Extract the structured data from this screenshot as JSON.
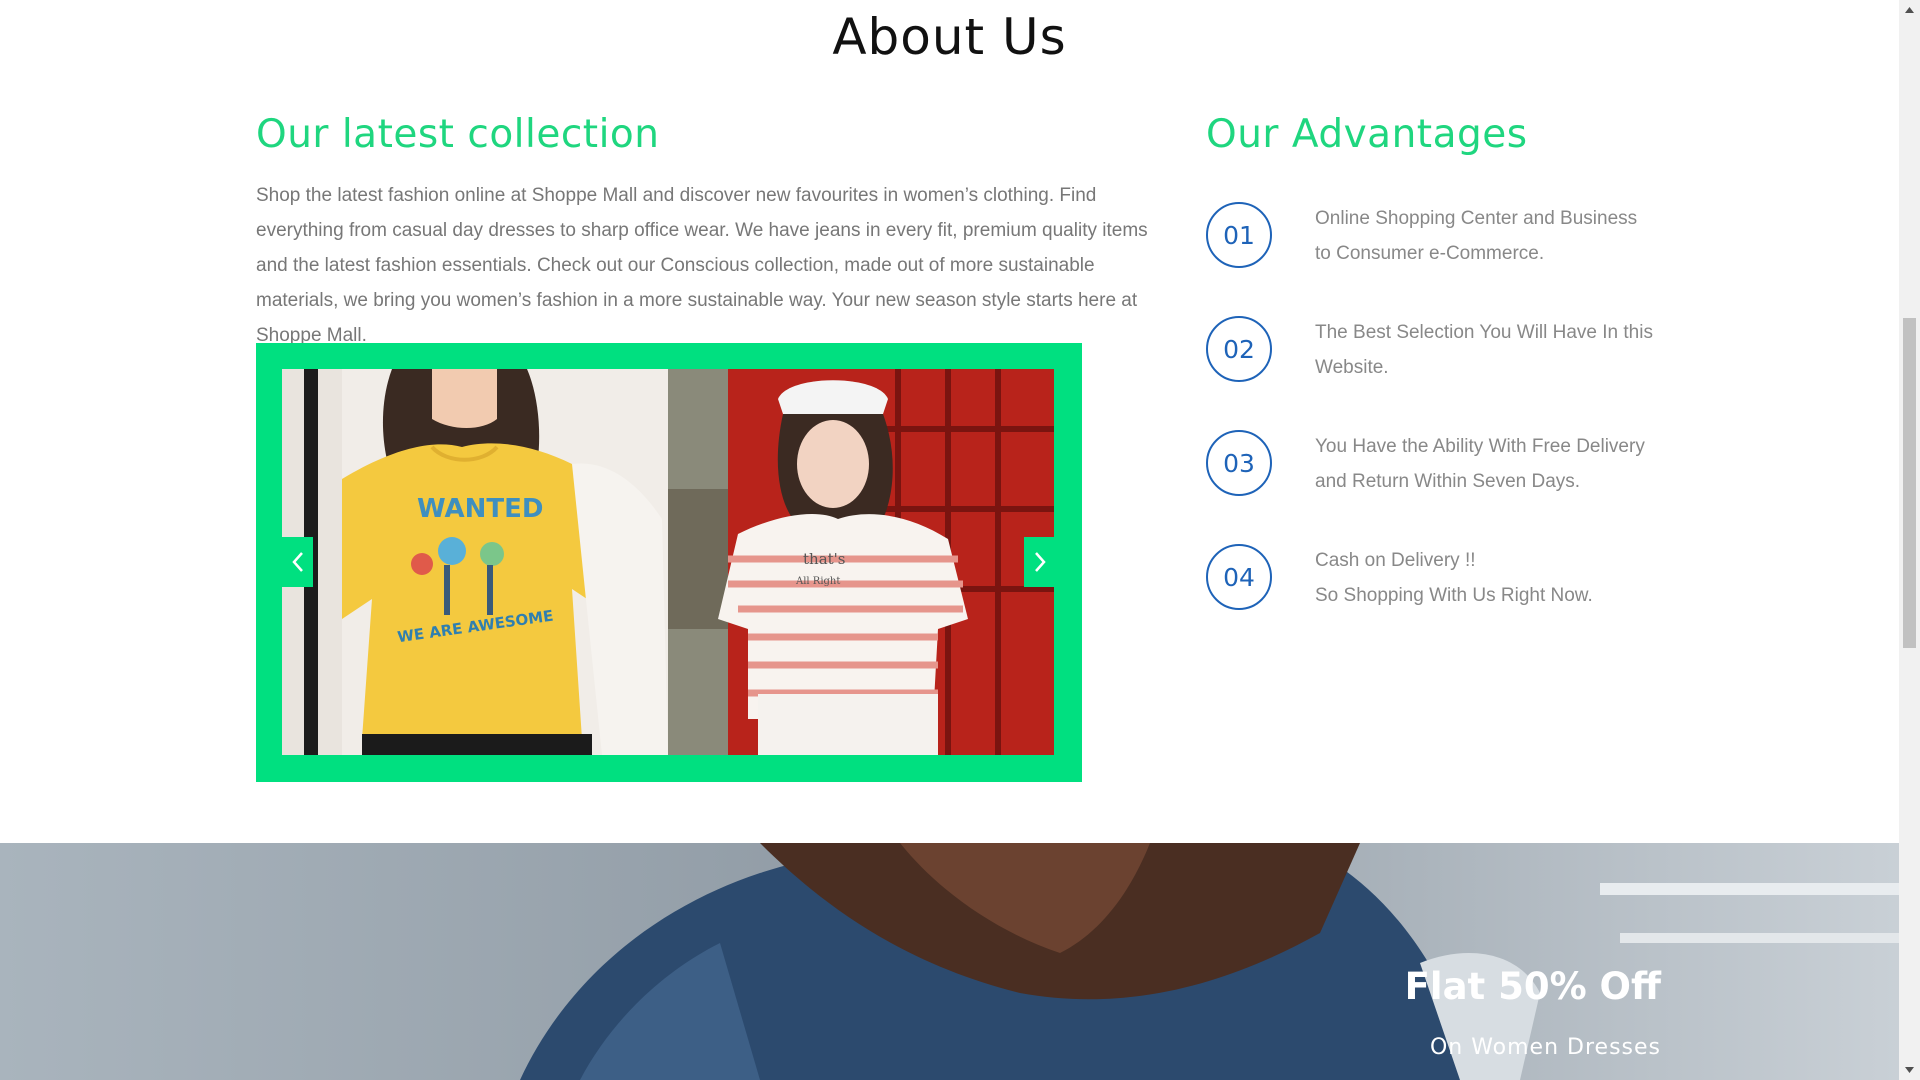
{
  "about": {
    "title": "About Us"
  },
  "collection": {
    "heading": "Our latest collection",
    "description": "Shop the latest fashion online at Shoppe Mall and discover new favourites in women’s clothing. Find everything from casual day dresses to sharp office wear. We have jeans in every fit, premium quality items and the latest fashion essentials. Check out our Conscious collection, made out of more sustainable materials, we bring you women’s fashion in a more sustainable way. Your new season style starts here at Shoppe Mall."
  },
  "slider": {
    "prev_icon": "chevron-left-icon",
    "next_icon": "chevron-right-icon",
    "images": [
      {
        "tshirt_text_top": "WANTED",
        "tshirt_text_bottom": "WE ARE AWESOME"
      },
      {
        "tshirt_text_top": "that's",
        "tshirt_text_bottom": "All Right"
      }
    ]
  },
  "advantages": {
    "heading": "Our Advantages",
    "items": [
      {
        "number": "01",
        "line1": "Online Shopping Center and Business",
        "line2": "to Consumer e-Commerce."
      },
      {
        "number": "02",
        "line1": "The Best Selection You Will Have In this",
        "line2": "Website."
      },
      {
        "number": "03",
        "line1": "You Have the Ability With Free Delivery",
        "line2": "and Return Within Seven Days."
      },
      {
        "number": "04",
        "line1": "Cash on Delivery !!",
        "line2": "So Shopping With Us Right Now."
      }
    ]
  },
  "banner": {
    "title": "Flat 50% Off",
    "subtitle": "On Women Dresses"
  },
  "colors": {
    "accent": "#1fd67f",
    "slider_frame": "#00e080",
    "number_blue": "#1e63b8",
    "body_text": "#777777"
  }
}
